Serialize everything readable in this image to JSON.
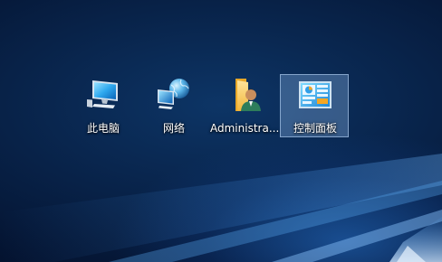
{
  "desktop": {
    "icons": [
      {
        "label": "此电脑",
        "icon": "this-pc-icon",
        "selected": false
      },
      {
        "label": "网络",
        "icon": "network-icon",
        "selected": false
      },
      {
        "label": "Administra...",
        "icon": "user-folder-icon",
        "selected": false
      },
      {
        "label": "控制面板",
        "icon": "control-panel-icon",
        "selected": true
      }
    ]
  },
  "colors": {
    "background_dark": "#041330",
    "background_mid": "#0d3566",
    "selection_fill": "#80aadc",
    "label_text": "#ffffff"
  }
}
